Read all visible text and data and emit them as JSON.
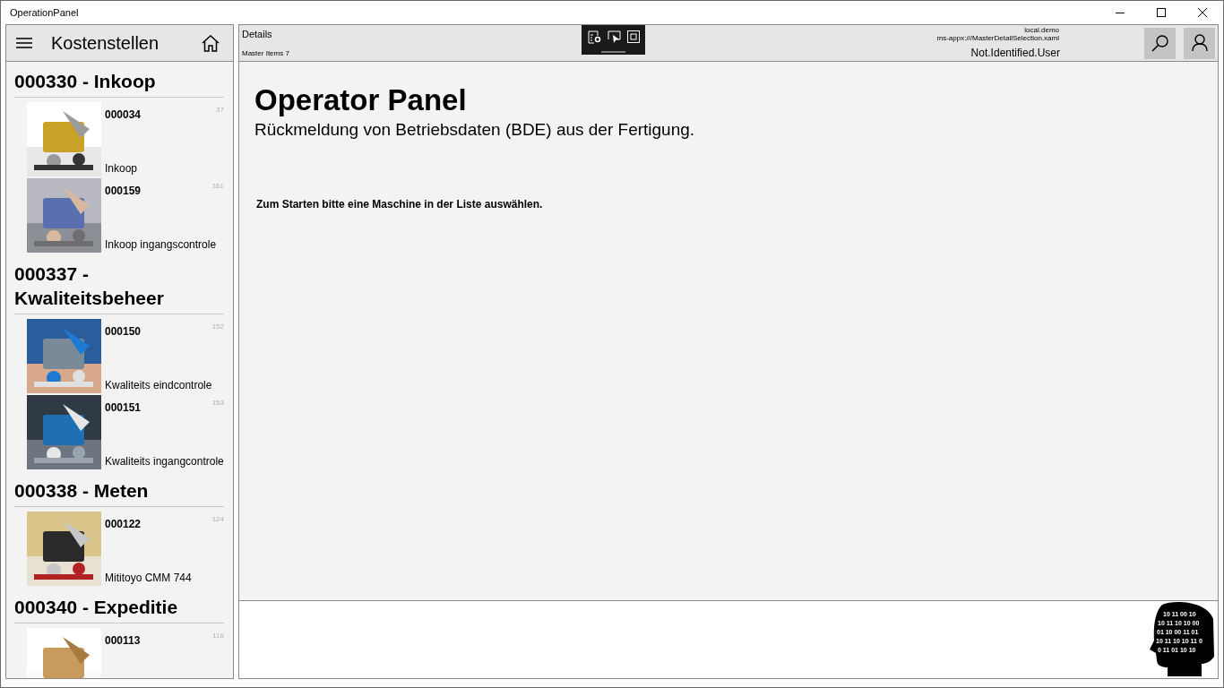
{
  "window": {
    "title": "OperationPanel"
  },
  "master": {
    "title": "Kostenstellen",
    "groups": [
      {
        "title": "000330 - Inkoop",
        "items": [
          {
            "code": "000034",
            "name": "Inkoop",
            "count": "37"
          },
          {
            "code": "000159",
            "name": "Inkoop ingangscontrole",
            "count": "161"
          }
        ]
      },
      {
        "title": "000337 - Kwaliteitsbeheer",
        "items": [
          {
            "code": "000150",
            "name": "Kwaliteits eindcontrole",
            "count": "152"
          },
          {
            "code": "000151",
            "name": "Kwaliteits ingangcontrole",
            "count": "153"
          }
        ]
      },
      {
        "title": "000338 - Meten",
        "items": [
          {
            "code": "000122",
            "name": "Mititoyo CMM 744",
            "count": "124"
          }
        ]
      },
      {
        "title": "000340 - Expeditie",
        "items": [
          {
            "code": "000113",
            "count": "116"
          }
        ]
      }
    ]
  },
  "detail": {
    "header": "Details",
    "master_count": "Master Items 7",
    "server": "local.demo",
    "page": "ms-appx:///MasterDetailSelection.xaml",
    "user": "Not.Identified.User",
    "heading": "Operator Panel",
    "subtitle": "Rückmeldung von Betriebsdaten (BDE) aus der Fertigung.",
    "instruction": "Zum Starten bitte eine Maschine in der Liste auswählen.",
    "logo_lines": [
      "10 11 00 10",
      "10 11 10 10 00",
      "01 10 00 11 01",
      "10 11 10 10 11 0",
      "0 11 01 10 10"
    ]
  }
}
